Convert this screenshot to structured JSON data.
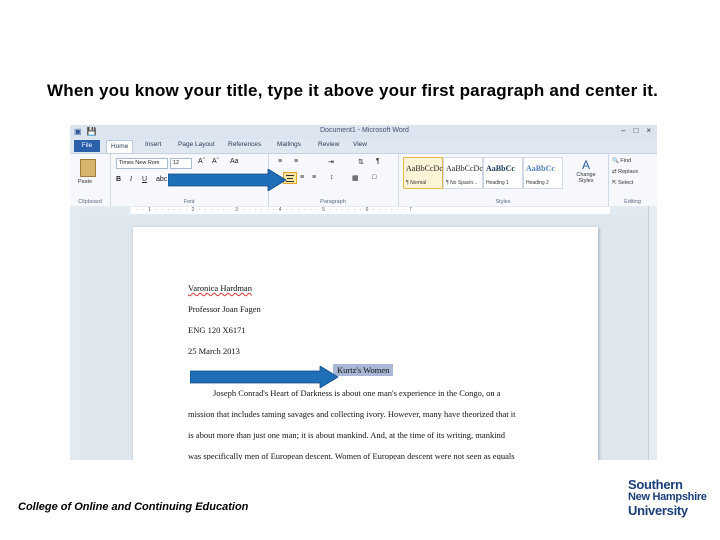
{
  "slide": {
    "title": "When you know your title, type it above your first paragraph and center it.",
    "footer": "College of Online and Continuing Education",
    "logo": [
      "Southern",
      "New Hampshire",
      "University"
    ]
  },
  "word": {
    "window_title": "Document1 - Microsoft Word",
    "tabs": [
      "File",
      "Home",
      "Insert",
      "Page Layout",
      "References",
      "Mailings",
      "Review",
      "View"
    ],
    "clipboard": {
      "paste": "Paste",
      "label": "Clipboard"
    },
    "font": {
      "name": "Times New Rom",
      "size": "12",
      "label": "Font",
      "bold": "B",
      "italic": "I",
      "underline": "U"
    },
    "paragraph": {
      "label": "Paragraph"
    },
    "styles": {
      "label": "Styles",
      "tiles": [
        {
          "sample": "AaBbCcDc",
          "name": "¶ Normal"
        },
        {
          "sample": "AaBbCcDc",
          "name": "¶ No Spacin..."
        },
        {
          "sample": "AaBbCc",
          "name": "Heading 1"
        },
        {
          "sample": "AaBbCc",
          "name": "Heading 2"
        }
      ],
      "change_styles": "Change Styles"
    },
    "editing": {
      "find": "Find",
      "replace": "Replace",
      "select": "Select",
      "label": "Editing"
    },
    "document": {
      "lines": [
        "Varonica Hardman",
        "Professor Joan Fagen",
        "ENG 120 X6171",
        "25 March 2013"
      ],
      "title": "Kurtz's Women",
      "body": [
        "Joseph Conrad's Heart of Darkness is about one man's experience in the Congo, on a",
        "mission that includes taming savages and collecting ivory. However, many have theorized that it",
        "is about more than just one man; it is about mankind. And, at the time of its writing, mankind",
        "was specifically men of European descent. Women of European descent were not seen as equals"
      ]
    }
  },
  "colors": {
    "arrow": "#1f6fb8",
    "title_highlight": "#a9b6d6",
    "logo": "#1a3f78"
  }
}
